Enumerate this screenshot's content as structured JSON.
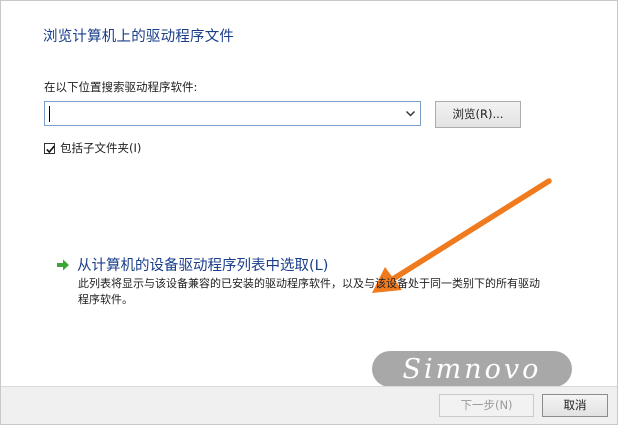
{
  "dialog": {
    "title": "浏览计算机上的驱动程序文件",
    "search_label": "在以下位置搜索驱动程序软件:",
    "path_value": "",
    "browse_label": "浏览(R)...",
    "include_subfolders_label": "包括子文件夹(I)",
    "include_subfolders_checked": true,
    "pick_label": "从计算机的设备驱动程序列表中选取(L)",
    "pick_description": "此列表将显示与该设备兼容的已安装的驱动程序软件，以及与该设备处于同一类别下的所有驱动程序软件。"
  },
  "watermark": {
    "text": "Simnovo"
  },
  "footer": {
    "next_label": "下一步(N)",
    "cancel_label": "取消"
  },
  "colors": {
    "link_blue": "#1a3e8a",
    "annotation_orange": "#f07a1e",
    "green_arrow": "#3aa63a"
  },
  "icons": {
    "combo": "chevron-down-icon",
    "checkbox": "check-icon",
    "link": "green-arrow-icon",
    "annotation": "orange-arrow-icon"
  }
}
